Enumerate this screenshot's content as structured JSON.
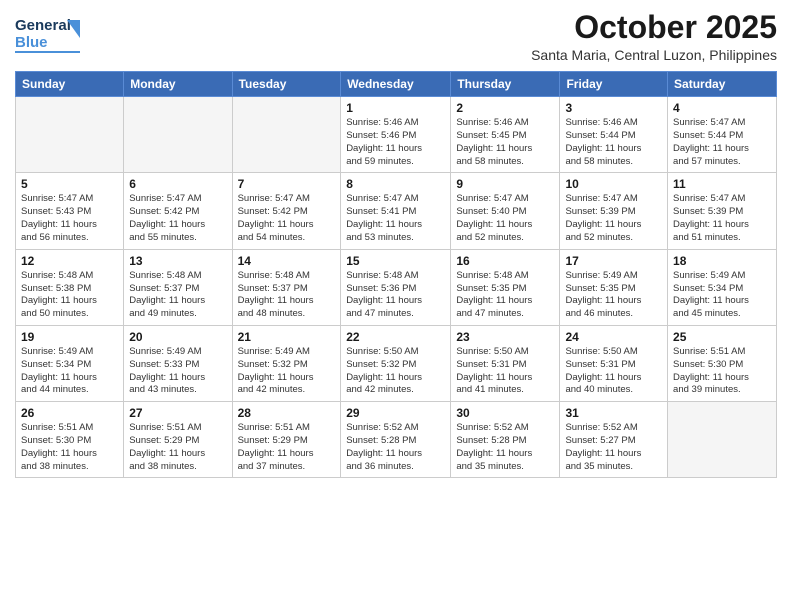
{
  "header": {
    "logo_general": "General",
    "logo_blue": "Blue",
    "month_title": "October 2025",
    "location": "Santa Maria, Central Luzon, Philippines"
  },
  "days_of_week": [
    "Sunday",
    "Monday",
    "Tuesday",
    "Wednesday",
    "Thursday",
    "Friday",
    "Saturday"
  ],
  "weeks": [
    [
      {
        "day": "",
        "info": ""
      },
      {
        "day": "",
        "info": ""
      },
      {
        "day": "",
        "info": ""
      },
      {
        "day": "1",
        "info": "Sunrise: 5:46 AM\nSunset: 5:46 PM\nDaylight: 11 hours\nand 59 minutes."
      },
      {
        "day": "2",
        "info": "Sunrise: 5:46 AM\nSunset: 5:45 PM\nDaylight: 11 hours\nand 58 minutes."
      },
      {
        "day": "3",
        "info": "Sunrise: 5:46 AM\nSunset: 5:44 PM\nDaylight: 11 hours\nand 58 minutes."
      },
      {
        "day": "4",
        "info": "Sunrise: 5:47 AM\nSunset: 5:44 PM\nDaylight: 11 hours\nand 57 minutes."
      }
    ],
    [
      {
        "day": "5",
        "info": "Sunrise: 5:47 AM\nSunset: 5:43 PM\nDaylight: 11 hours\nand 56 minutes."
      },
      {
        "day": "6",
        "info": "Sunrise: 5:47 AM\nSunset: 5:42 PM\nDaylight: 11 hours\nand 55 minutes."
      },
      {
        "day": "7",
        "info": "Sunrise: 5:47 AM\nSunset: 5:42 PM\nDaylight: 11 hours\nand 54 minutes."
      },
      {
        "day": "8",
        "info": "Sunrise: 5:47 AM\nSunset: 5:41 PM\nDaylight: 11 hours\nand 53 minutes."
      },
      {
        "day": "9",
        "info": "Sunrise: 5:47 AM\nSunset: 5:40 PM\nDaylight: 11 hours\nand 52 minutes."
      },
      {
        "day": "10",
        "info": "Sunrise: 5:47 AM\nSunset: 5:39 PM\nDaylight: 11 hours\nand 52 minutes."
      },
      {
        "day": "11",
        "info": "Sunrise: 5:47 AM\nSunset: 5:39 PM\nDaylight: 11 hours\nand 51 minutes."
      }
    ],
    [
      {
        "day": "12",
        "info": "Sunrise: 5:48 AM\nSunset: 5:38 PM\nDaylight: 11 hours\nand 50 minutes."
      },
      {
        "day": "13",
        "info": "Sunrise: 5:48 AM\nSunset: 5:37 PM\nDaylight: 11 hours\nand 49 minutes."
      },
      {
        "day": "14",
        "info": "Sunrise: 5:48 AM\nSunset: 5:37 PM\nDaylight: 11 hours\nand 48 minutes."
      },
      {
        "day": "15",
        "info": "Sunrise: 5:48 AM\nSunset: 5:36 PM\nDaylight: 11 hours\nand 47 minutes."
      },
      {
        "day": "16",
        "info": "Sunrise: 5:48 AM\nSunset: 5:35 PM\nDaylight: 11 hours\nand 47 minutes."
      },
      {
        "day": "17",
        "info": "Sunrise: 5:49 AM\nSunset: 5:35 PM\nDaylight: 11 hours\nand 46 minutes."
      },
      {
        "day": "18",
        "info": "Sunrise: 5:49 AM\nSunset: 5:34 PM\nDaylight: 11 hours\nand 45 minutes."
      }
    ],
    [
      {
        "day": "19",
        "info": "Sunrise: 5:49 AM\nSunset: 5:34 PM\nDaylight: 11 hours\nand 44 minutes."
      },
      {
        "day": "20",
        "info": "Sunrise: 5:49 AM\nSunset: 5:33 PM\nDaylight: 11 hours\nand 43 minutes."
      },
      {
        "day": "21",
        "info": "Sunrise: 5:49 AM\nSunset: 5:32 PM\nDaylight: 11 hours\nand 42 minutes."
      },
      {
        "day": "22",
        "info": "Sunrise: 5:50 AM\nSunset: 5:32 PM\nDaylight: 11 hours\nand 42 minutes."
      },
      {
        "day": "23",
        "info": "Sunrise: 5:50 AM\nSunset: 5:31 PM\nDaylight: 11 hours\nand 41 minutes."
      },
      {
        "day": "24",
        "info": "Sunrise: 5:50 AM\nSunset: 5:31 PM\nDaylight: 11 hours\nand 40 minutes."
      },
      {
        "day": "25",
        "info": "Sunrise: 5:51 AM\nSunset: 5:30 PM\nDaylight: 11 hours\nand 39 minutes."
      }
    ],
    [
      {
        "day": "26",
        "info": "Sunrise: 5:51 AM\nSunset: 5:30 PM\nDaylight: 11 hours\nand 38 minutes."
      },
      {
        "day": "27",
        "info": "Sunrise: 5:51 AM\nSunset: 5:29 PM\nDaylight: 11 hours\nand 38 minutes."
      },
      {
        "day": "28",
        "info": "Sunrise: 5:51 AM\nSunset: 5:29 PM\nDaylight: 11 hours\nand 37 minutes."
      },
      {
        "day": "29",
        "info": "Sunrise: 5:52 AM\nSunset: 5:28 PM\nDaylight: 11 hours\nand 36 minutes."
      },
      {
        "day": "30",
        "info": "Sunrise: 5:52 AM\nSunset: 5:28 PM\nDaylight: 11 hours\nand 35 minutes."
      },
      {
        "day": "31",
        "info": "Sunrise: 5:52 AM\nSunset: 5:27 PM\nDaylight: 11 hours\nand 35 minutes."
      },
      {
        "day": "",
        "info": ""
      }
    ]
  ]
}
